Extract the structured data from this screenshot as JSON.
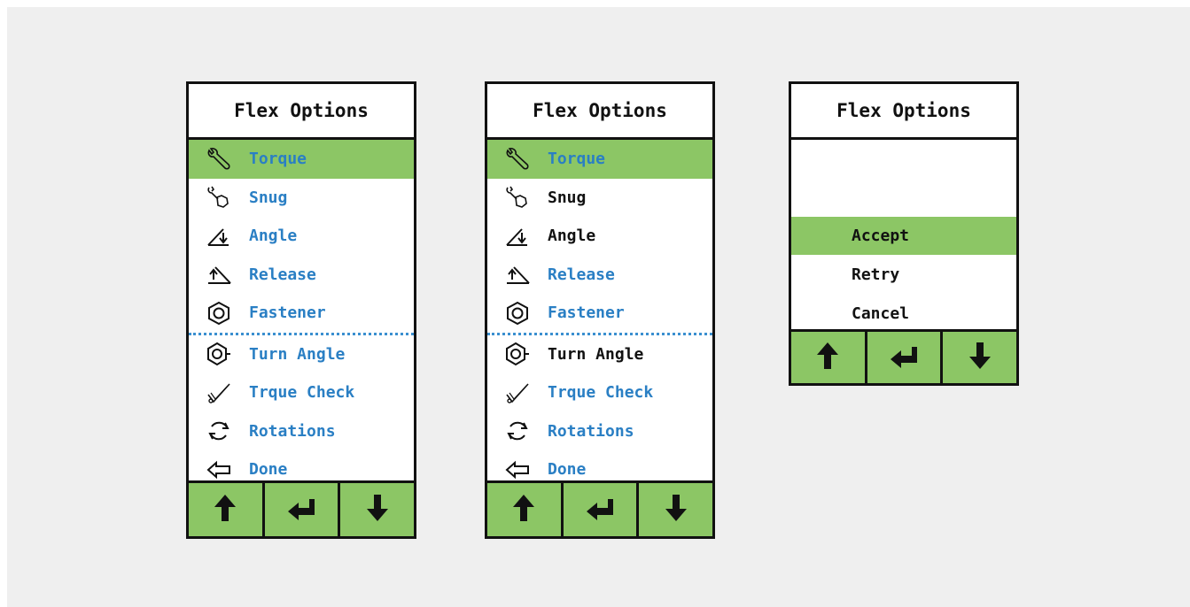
{
  "panels": [
    {
      "title": "Flex Options",
      "items": [
        {
          "label": "Torque",
          "icon": "wrench-icon",
          "color": "blue",
          "selected": true
        },
        {
          "label": "Snug",
          "icon": "snug-icon",
          "color": "blue",
          "selected": false
        },
        {
          "label": "Angle",
          "icon": "angle-icon",
          "color": "blue",
          "selected": false
        },
        {
          "label": "Release",
          "icon": "release-icon",
          "color": "blue",
          "selected": false
        },
        {
          "label": "Fastener",
          "icon": "hex-nut-icon",
          "color": "blue",
          "selected": false
        },
        {
          "label": "Turn Angle",
          "icon": "turn-angle-icon",
          "color": "blue",
          "selected": false
        },
        {
          "label": "Trque Check",
          "icon": "check-wrench-icon",
          "color": "blue",
          "selected": false
        },
        {
          "label": "Rotations",
          "icon": "rotate-icon",
          "color": "blue",
          "selected": false
        },
        {
          "label": "Done",
          "icon": "back-arrow-icon",
          "color": "blue",
          "selected": false
        }
      ]
    },
    {
      "title": "Flex Options",
      "items": [
        {
          "label": "Torque",
          "icon": "wrench-icon",
          "color": "blue",
          "selected": true
        },
        {
          "label": "Snug",
          "icon": "snug-icon",
          "color": "black",
          "selected": false
        },
        {
          "label": "Angle",
          "icon": "angle-icon",
          "color": "black",
          "selected": false
        },
        {
          "label": "Release",
          "icon": "release-icon",
          "color": "blue",
          "selected": false
        },
        {
          "label": "Fastener",
          "icon": "hex-nut-icon",
          "color": "blue",
          "selected": false
        },
        {
          "label": "Turn Angle",
          "icon": "turn-angle-icon",
          "color": "black",
          "selected": false
        },
        {
          "label": "Trque Check",
          "icon": "check-wrench-icon",
          "color": "blue",
          "selected": false
        },
        {
          "label": "Rotations",
          "icon": "rotate-icon",
          "color": "blue",
          "selected": false
        },
        {
          "label": "Done",
          "icon": "back-arrow-icon",
          "color": "blue",
          "selected": false
        }
      ]
    },
    {
      "title": "Flex Options",
      "items": [
        {
          "label": "Accept",
          "selected": true
        },
        {
          "label": "Retry",
          "selected": false
        },
        {
          "label": "Cancel",
          "selected": false
        }
      ]
    }
  ],
  "footer_buttons": [
    {
      "icon": "arrow-up-icon"
    },
    {
      "icon": "enter-icon"
    },
    {
      "icon": "arrow-down-icon"
    }
  ],
  "colors": {
    "selected_bg": "#8cc665",
    "footer_bg": "#8cc665",
    "blue_text": "#2a7fc4",
    "black_text": "#111111",
    "divider": "#3a8fd0"
  }
}
